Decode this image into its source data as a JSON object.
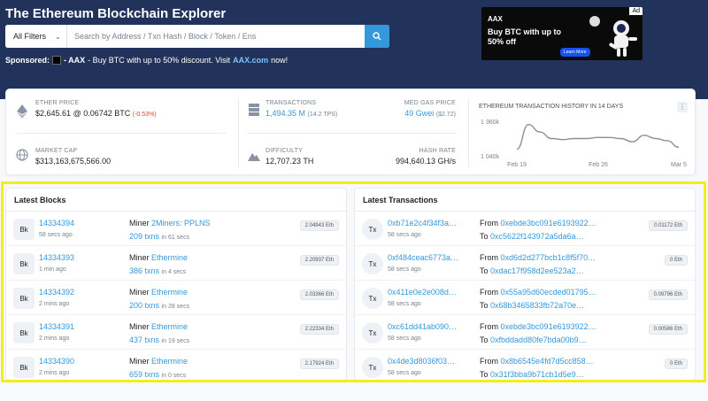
{
  "header": {
    "title": "The Ethereum Blockchain Explorer",
    "filter_label": "All Filters",
    "search_placeholder": "Search by Address / Txn Hash / Block / Token / Ens"
  },
  "sponsored": {
    "label": "Sponsored:",
    "name": "- AAX",
    "text": "- Buy BTC with up to 50% discount. Visit",
    "link": "AAX.com",
    "suffix": "now!"
  },
  "ad": {
    "tag": "Ad",
    "brand": "AAX",
    "text": "Buy BTC with up to 50% off",
    "button": "Learn More"
  },
  "stats": {
    "ether_price": {
      "label": "ETHER PRICE",
      "value": "$2,645.61",
      "btc": "@ 0.06742 BTC",
      "change": "(-0.53%)"
    },
    "market_cap": {
      "label": "MARKET CAP",
      "value": "$313,163,675,566.00"
    },
    "transactions": {
      "label": "TRANSACTIONS",
      "value": "1,494.35 M",
      "tps": "(14.2 TPS)"
    },
    "med_gas": {
      "label": "MED GAS PRICE",
      "value": "49 Gwei",
      "usd": "($2.72)"
    },
    "difficulty": {
      "label": "DIFFICULTY",
      "value": "12,707.23 TH"
    },
    "hash_rate": {
      "label": "HASH RATE",
      "value": "994,640.13 GH/s"
    }
  },
  "chart_data": {
    "type": "line",
    "title": "ETHEREUM TRANSACTION HISTORY IN 14 DAYS",
    "x": [
      "Feb 19",
      "Feb 20",
      "Feb 21",
      "Feb 22",
      "Feb 23",
      "Feb 24",
      "Feb 25",
      "Feb 26",
      "Feb 27",
      "Feb 28",
      "Mar 1",
      "Mar 2",
      "Mar 3",
      "Mar 4",
      "Mar 5"
    ],
    "values": [
      1.1,
      1.33,
      1.26,
      1.2,
      1.19,
      1.2,
      1.2,
      1.21,
      1.21,
      1.2,
      1.17,
      1.23,
      1.2,
      1.18,
      1.12
    ],
    "unit": "M",
    "y_ticks": [
      "1 360k",
      "1 040k"
    ],
    "ylim": [
      1.04,
      1.36
    ],
    "x_ticks": [
      "Feb 19",
      "Feb 26",
      "Mar 5"
    ],
    "grid": false,
    "legend": "none"
  },
  "latest_blocks": {
    "title": "Latest Blocks",
    "rows": [
      {
        "avatar": "Bk",
        "block": "14334394",
        "age": "58 secs ago",
        "miner_label": "Miner",
        "miner": "2Miners: PPLNS",
        "txns": "209 txns",
        "time": "in 61 secs",
        "reward": "2.04943 Eth"
      },
      {
        "avatar": "Bk",
        "block": "14334393",
        "age": "1 min ago",
        "miner_label": "Miner",
        "miner": "Ethermine",
        "txns": "386 txns",
        "time": "in 4 secs",
        "reward": "2.20937 Eth"
      },
      {
        "avatar": "Bk",
        "block": "14334392",
        "age": "2 mins ago",
        "miner_label": "Miner",
        "miner": "Ethermine",
        "txns": "200 txns",
        "time": "in 28 secs",
        "reward": "2.03366 Eth"
      },
      {
        "avatar": "Bk",
        "block": "14334391",
        "age": "2 mins ago",
        "miner_label": "Miner",
        "miner": "Ethermine",
        "txns": "437 txns",
        "time": "in 19 secs",
        "reward": "2.22334 Eth"
      },
      {
        "avatar": "Bk",
        "block": "14334390",
        "age": "2 mins ago",
        "miner_label": "Miner",
        "miner": "Ethermine",
        "txns": "659 txns",
        "time": "in 0 secs",
        "reward": "2.17924 Eth"
      }
    ]
  },
  "latest_transactions": {
    "title": "Latest Transactions",
    "rows": [
      {
        "avatar": "Tx",
        "hash": "0xb71e2c4f34f3a…",
        "age": "58 secs ago",
        "from_label": "From",
        "from": "0xebde3bc091e6193922…",
        "to_label": "To",
        "to": "0xc5622f143972a5da6a…",
        "value": "0.01172 Eth"
      },
      {
        "avatar": "Tx",
        "hash": "0xf484ceac6773a…",
        "age": "58 secs ago",
        "from_label": "From",
        "from": "0xd6d2d277bcb1c8f5f70…",
        "to_label": "To",
        "to": "0xdac17f958d2ee523a2…",
        "value": "0 Eth"
      },
      {
        "avatar": "Tx",
        "hash": "0x411e0e2e008d…",
        "age": "58 secs ago",
        "from_label": "From",
        "from": "0x55a95d60ecded01795…",
        "to_label": "To",
        "to": "0x68b3465833fb72a70e…",
        "value": "0.09796 Eth"
      },
      {
        "avatar": "Tx",
        "hash": "0xc61dd41ab090…",
        "age": "58 secs ago",
        "from_label": "From",
        "from": "0xebde3bc091e6193922…",
        "to_label": "To",
        "to": "0xfbddadd80fe7bda00b9…",
        "value": "0.00586 Eth"
      },
      {
        "avatar": "Tx",
        "hash": "0x4de3d8036f03…",
        "age": "58 secs ago",
        "from_label": "From",
        "from": "0x8b6545e4fd7d5cc858…",
        "to_label": "To",
        "to": "0x31f3bba9b71cb1d5e9…",
        "value": "0 Eth"
      }
    ]
  },
  "colors": {
    "hero": "#21325b",
    "link": "#3498db",
    "negative": "#de4437",
    "highlight": "#f3ec20"
  }
}
